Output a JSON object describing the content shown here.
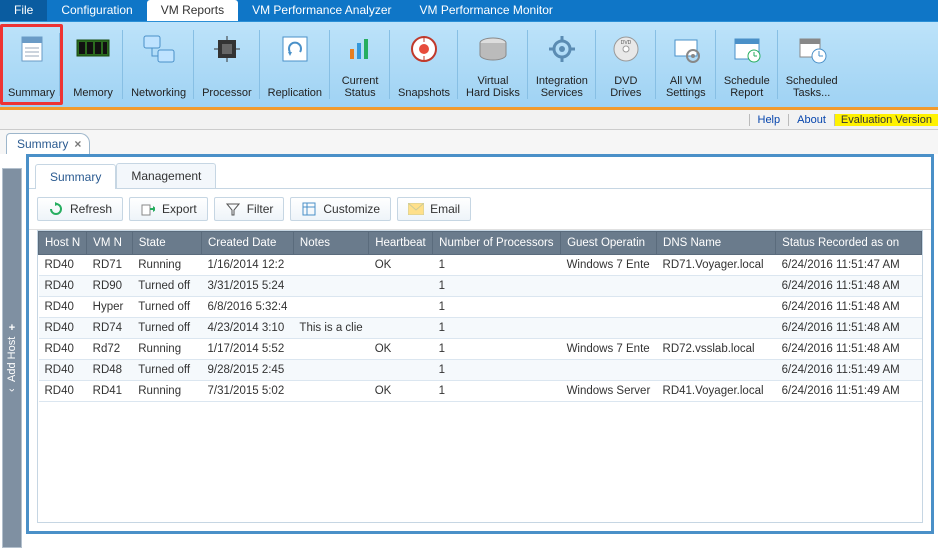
{
  "menubar": {
    "file": "File",
    "configuration": "Configuration",
    "vm_reports": "VM Reports",
    "vm_perf_analyzer": "VM Performance Analyzer",
    "vm_perf_monitor": "VM Performance Monitor"
  },
  "ribbon": {
    "summary": "Summary",
    "memory": "Memory",
    "networking": "Networking",
    "processor": "Processor",
    "replication": "Replication",
    "current_status": "Current\nStatus",
    "snapshots": "Snapshots",
    "virtual_hard_disks": "Virtual\nHard Disks",
    "integration_services": "Integration\nServices",
    "dvd_drives": "DVD\nDrives",
    "all_vm_settings": "All VM\nSettings",
    "schedule_report": "Schedule\nReport",
    "scheduled_tasks": "Scheduled\nTasks..."
  },
  "subbar": {
    "help": "Help",
    "about": "About",
    "eval": "Evaluation Version"
  },
  "tabstrip": {
    "summary": "Summary",
    "close": "×"
  },
  "sidebar": {
    "add_host": "Add Host",
    "caret": "‹"
  },
  "subtabs": {
    "summary": "Summary",
    "management": "Management"
  },
  "toolbar": {
    "refresh": "Refresh",
    "export": "Export",
    "filter": "Filter",
    "customize": "Customize",
    "email": "Email"
  },
  "columns": {
    "host": "Host N",
    "vm": "VM N",
    "state": "State",
    "created": "Created Date",
    "notes": "Notes",
    "heartbeat": "Heartbeat",
    "processors": "Number of Processors",
    "guest_os": "Guest Operatin",
    "dns": "DNS Name",
    "status_time": "Status Recorded as on"
  },
  "rows": [
    {
      "host": "RD40",
      "vm": "RD71",
      "state": "Running",
      "created": "1/16/2014 12:2",
      "notes": "",
      "heartbeat": "OK",
      "procs": "1",
      "guest": "Windows 7 Ente",
      "dns": "RD71.Voyager.local",
      "status": "6/24/2016 11:51:47 AM"
    },
    {
      "host": "RD40",
      "vm": "RD90",
      "state": "Turned off",
      "created": "3/31/2015 5:24",
      "notes": "",
      "heartbeat": "",
      "procs": "1",
      "guest": "",
      "dns": "",
      "status": "6/24/2016 11:51:48 AM"
    },
    {
      "host": "RD40",
      "vm": "Hyper",
      "state": "Turned off",
      "created": "6/8/2016 5:32:4",
      "notes": "",
      "heartbeat": "",
      "procs": "1",
      "guest": "",
      "dns": "",
      "status": "6/24/2016 11:51:48 AM"
    },
    {
      "host": "RD40",
      "vm": "RD74",
      "state": "Turned off",
      "created": "4/23/2014 3:10",
      "notes": "This is a clie",
      "heartbeat": "",
      "procs": "1",
      "guest": "",
      "dns": "",
      "status": "6/24/2016 11:51:48 AM"
    },
    {
      "host": "RD40",
      "vm": "Rd72",
      "state": "Running",
      "created": "1/17/2014 5:52",
      "notes": "",
      "heartbeat": "OK",
      "procs": "1",
      "guest": "Windows 7 Ente",
      "dns": "RD72.vsslab.local",
      "status": "6/24/2016 11:51:48 AM"
    },
    {
      "host": "RD40",
      "vm": "RD48",
      "state": "Turned off",
      "created": "9/28/2015 2:45",
      "notes": "",
      "heartbeat": "",
      "procs": "1",
      "guest": "",
      "dns": "",
      "status": "6/24/2016 11:51:49 AM"
    },
    {
      "host": "RD40",
      "vm": "RD41",
      "state": "Running",
      "created": "7/31/2015 5:02",
      "notes": "",
      "heartbeat": "OK",
      "procs": "1",
      "guest": "Windows Server",
      "dns": "RD41.Voyager.local",
      "status": "6/24/2016 11:51:49 AM"
    }
  ]
}
